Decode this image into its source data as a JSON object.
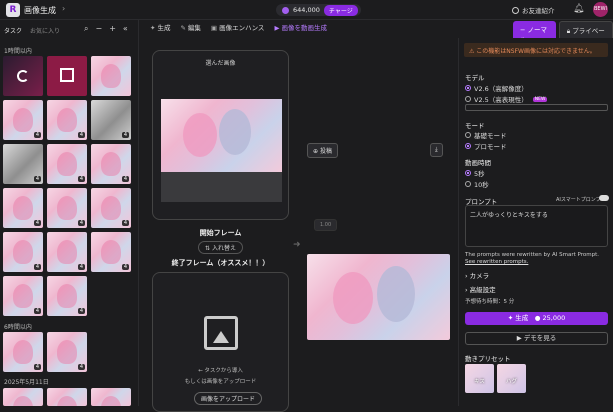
{
  "header": {
    "logo": "R",
    "title": "画像生成",
    "coins": "644,000",
    "charge": "チャージ",
    "invite": "お友達紹介",
    "avatar": "BEWI"
  },
  "left_panel": {
    "tabs": [
      "タスク",
      "お気に入り"
    ],
    "sections": [
      "1時間以内",
      "6時間以内",
      "2025年5月11日"
    ],
    "badges": [
      "4",
      "4",
      "4",
      "4",
      "4",
      "4",
      "4",
      "4",
      "4",
      "4",
      "4",
      "4",
      "4",
      "4",
      "4",
      "4"
    ]
  },
  "toolbar": {
    "items": [
      "生成",
      "編集",
      "画像エンハンス",
      "画像を動画生成"
    ]
  },
  "canvas": {
    "selected_image_title": "選んだ画像",
    "start_frame": "開始フレーム",
    "swap": "入れ替え",
    "end_frame": "終了フレーム（オススメ！！）",
    "post": "投稿",
    "duration_tag": "1.00",
    "upload_hint1": "← タスクから導入",
    "upload_hint2": "もしくは画像をアップロード",
    "upload_button": "画像をアップロード"
  },
  "right_panel": {
    "mode_normal": "ノーマル",
    "mode_private": "プライベート",
    "warning": "この機能はNSFW画像には対応できません。",
    "model_label": "モデル",
    "model_options": [
      "V2.6（高解像度）",
      "V2.5（高表現性）"
    ],
    "new_badge": "NEW",
    "mode_label": "モード",
    "mode_options": [
      "基礎モード",
      "プロモード"
    ],
    "duration_label": "動画時間",
    "duration_options": [
      "5秒",
      "10秒"
    ],
    "prompt_label": "プロンプト",
    "smart_prompt": "AIスマートプロンプト",
    "prompt_value": "二人がゆっくりとキスをする",
    "rewritten_note": "The prompts were rewritten by AI Smart Prompt.",
    "rewritten_link": "See rewritten prompts.",
    "camera": "カメラ",
    "advanced": "高級設定",
    "expected_time": "予想待ち時間：5 分",
    "generate": "生成",
    "generate_cost": "25,000",
    "demo": "デモを見る",
    "presets_label": "動きプリセット",
    "presets": [
      "キス",
      "ハグ"
    ]
  }
}
